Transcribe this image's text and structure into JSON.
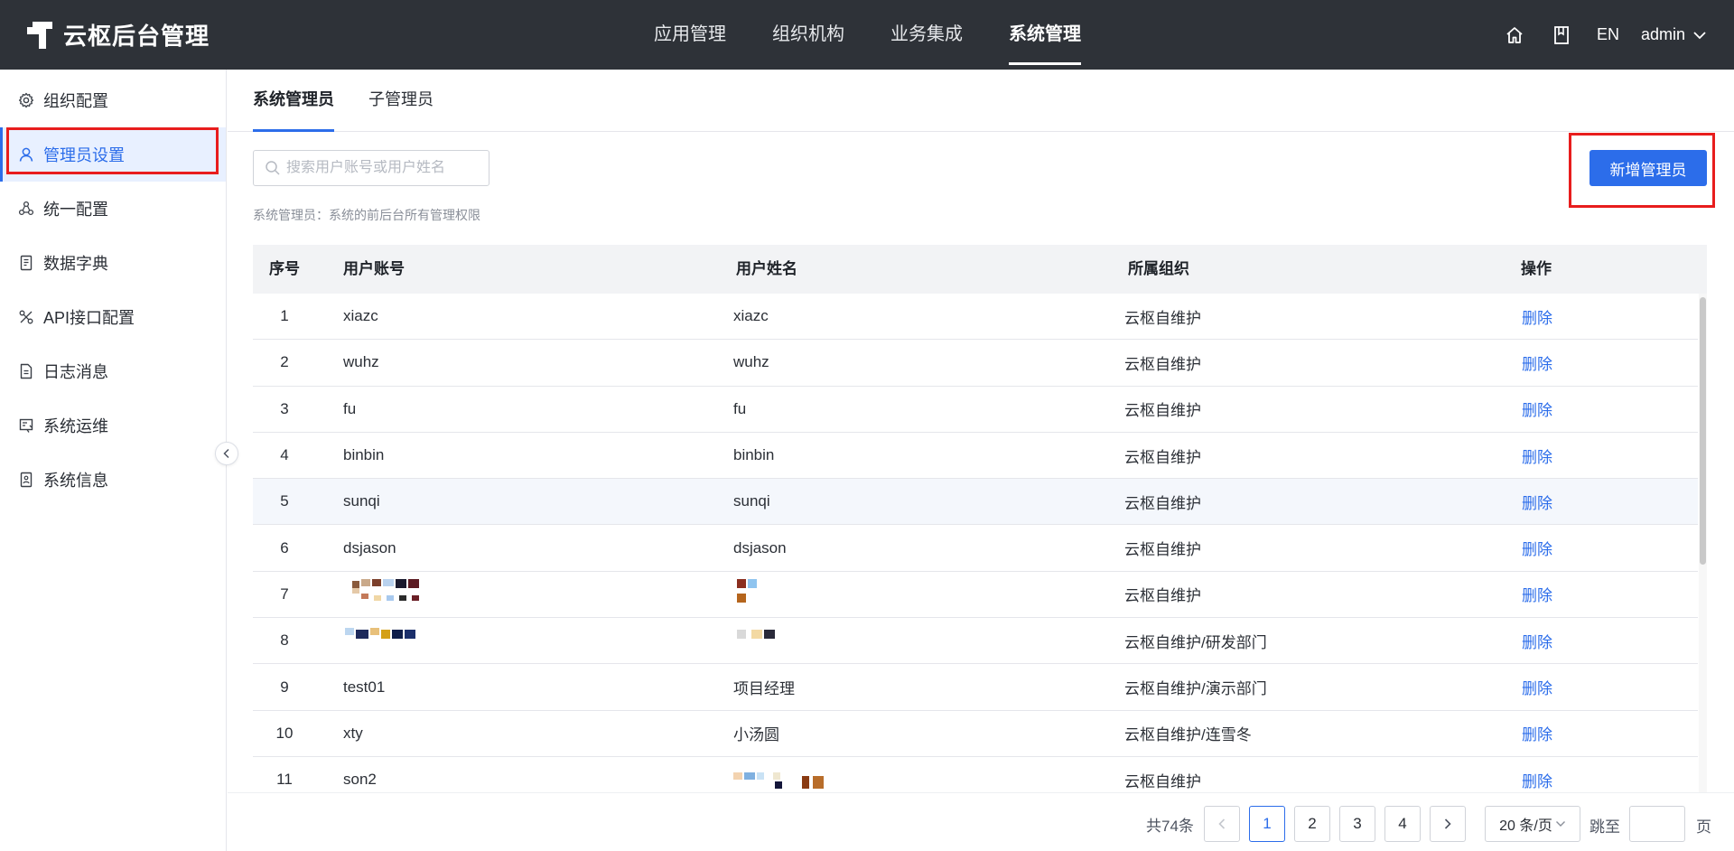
{
  "header": {
    "app_title": "云枢后台管理",
    "nav": [
      {
        "label": "应用管理",
        "active": false
      },
      {
        "label": "组织机构",
        "active": false
      },
      {
        "label": "业务集成",
        "active": false
      },
      {
        "label": "系统管理",
        "active": true
      }
    ],
    "home_icon": "home-icon",
    "book_icon": "book-icon",
    "lang_label": "EN",
    "user_label": "admin"
  },
  "sidebar": {
    "items": [
      {
        "label": "组织配置",
        "icon": "gear-icon",
        "active": false
      },
      {
        "label": "管理员设置",
        "icon": "user-icon",
        "active": true
      },
      {
        "label": "统一配置",
        "icon": "cluster-icon",
        "active": false
      },
      {
        "label": "数据字典",
        "icon": "dictionary-icon",
        "active": false
      },
      {
        "label": "API接口配置",
        "icon": "api-icon",
        "active": false
      },
      {
        "label": "日志消息",
        "icon": "log-icon",
        "active": false
      },
      {
        "label": "系统运维",
        "icon": "ops-icon",
        "active": false
      },
      {
        "label": "系统信息",
        "icon": "info-icon",
        "active": false
      }
    ]
  },
  "tabs": [
    {
      "label": "系统管理员",
      "active": true
    },
    {
      "label": "子管理员",
      "active": false
    }
  ],
  "search": {
    "placeholder": "搜索用户账号或用户姓名",
    "value": ""
  },
  "description": "系统管理员：系统的前后台所有管理权限",
  "add_button_label": "新增管理员",
  "table": {
    "headers": [
      "序号",
      "用户账号",
      "用户姓名",
      "所属组织",
      "操作"
    ],
    "rows": [
      {
        "index": "1",
        "account": "xiazc",
        "name": "xiazc",
        "org": "云枢自维护",
        "action": "删除"
      },
      {
        "index": "2",
        "account": "wuhz",
        "name": "wuhz",
        "org": "云枢自维护",
        "action": "删除"
      },
      {
        "index": "3",
        "account": "fu",
        "name": "fu",
        "org": "云枢自维护",
        "action": "删除"
      },
      {
        "index": "4",
        "account": "binbin",
        "name": "binbin",
        "org": "云枢自维护",
        "action": "删除"
      },
      {
        "index": "5",
        "account": "sunqi",
        "name": "sunqi",
        "org": "云枢自维护",
        "action": "删除"
      },
      {
        "index": "6",
        "account": "dsjason",
        "name": "dsjason",
        "org": "云枢自维护",
        "action": "删除"
      },
      {
        "index": "7",
        "account": "",
        "name": "",
        "org": "云枢自维护",
        "action": "删除"
      },
      {
        "index": "8",
        "account": "",
        "name": "",
        "org": "云枢自维护/研发部门",
        "action": "删除"
      },
      {
        "index": "9",
        "account": "test01",
        "name": "项目经理",
        "org": "云枢自维护/演示部门",
        "action": "删除"
      },
      {
        "index": "10",
        "account": "xty",
        "name": "小汤圆",
        "org": "云枢自维护/连雪冬",
        "action": "删除"
      },
      {
        "index": "11",
        "account": "son2",
        "name": "",
        "org": "云枢自维护",
        "action": "删除"
      }
    ]
  },
  "pagination": {
    "total_label": "共74条",
    "pages": [
      "1",
      "2",
      "3",
      "4"
    ],
    "current_page": "1",
    "page_size_label": "20 条/页",
    "jump_label": "跳至",
    "jump_suffix": "页",
    "jump_value": ""
  },
  "colors": {
    "accent": "#2c6dea",
    "topbar": "#2e3238",
    "highlight_box": "#e81d1d"
  }
}
